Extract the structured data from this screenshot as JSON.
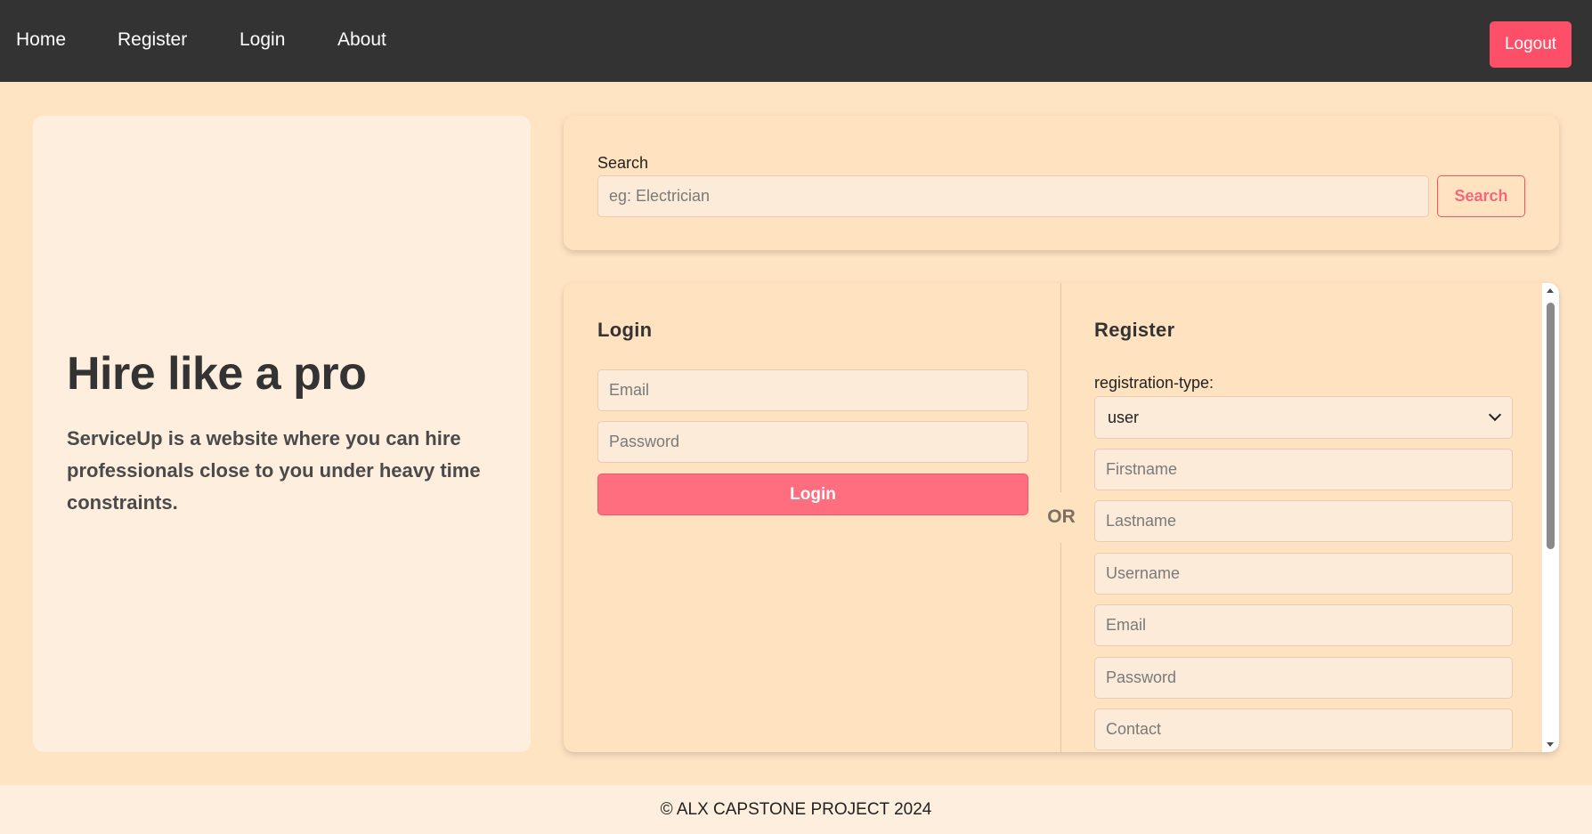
{
  "nav": {
    "links": [
      {
        "label": "Home"
      },
      {
        "label": "Register"
      },
      {
        "label": "Login"
      },
      {
        "label": "About"
      }
    ],
    "logout_label": "Logout"
  },
  "hero": {
    "title": "Hire like a pro",
    "description": "ServiceUp is a website where you can hire professionals close to you under heavy time constraints."
  },
  "search": {
    "label": "Search",
    "placeholder": "eg: Electrician",
    "value": "",
    "button_label": "Search"
  },
  "login": {
    "heading": "Login",
    "email_placeholder": "Email",
    "password_placeholder": "Password",
    "button_label": "Login"
  },
  "divider": {
    "text": "OR"
  },
  "register": {
    "heading": "Register",
    "type_label": "registration-type:",
    "type_selected": "user",
    "fields": [
      {
        "placeholder": "Firstname"
      },
      {
        "placeholder": "Lastname"
      },
      {
        "placeholder": "Username"
      },
      {
        "placeholder": "Email"
      },
      {
        "placeholder": "Password"
      },
      {
        "placeholder": "Contact"
      }
    ]
  },
  "footer": {
    "text": "© ALX CAPSTONE PROJECT 2024"
  },
  "colors": {
    "nav_bg": "#333333",
    "page_bg": "#ffe4c4",
    "accent": "#fd5068",
    "login_button": "#fe6e7e",
    "card_bg": "#ffe3c0",
    "hero_bg": "#fdeede"
  }
}
